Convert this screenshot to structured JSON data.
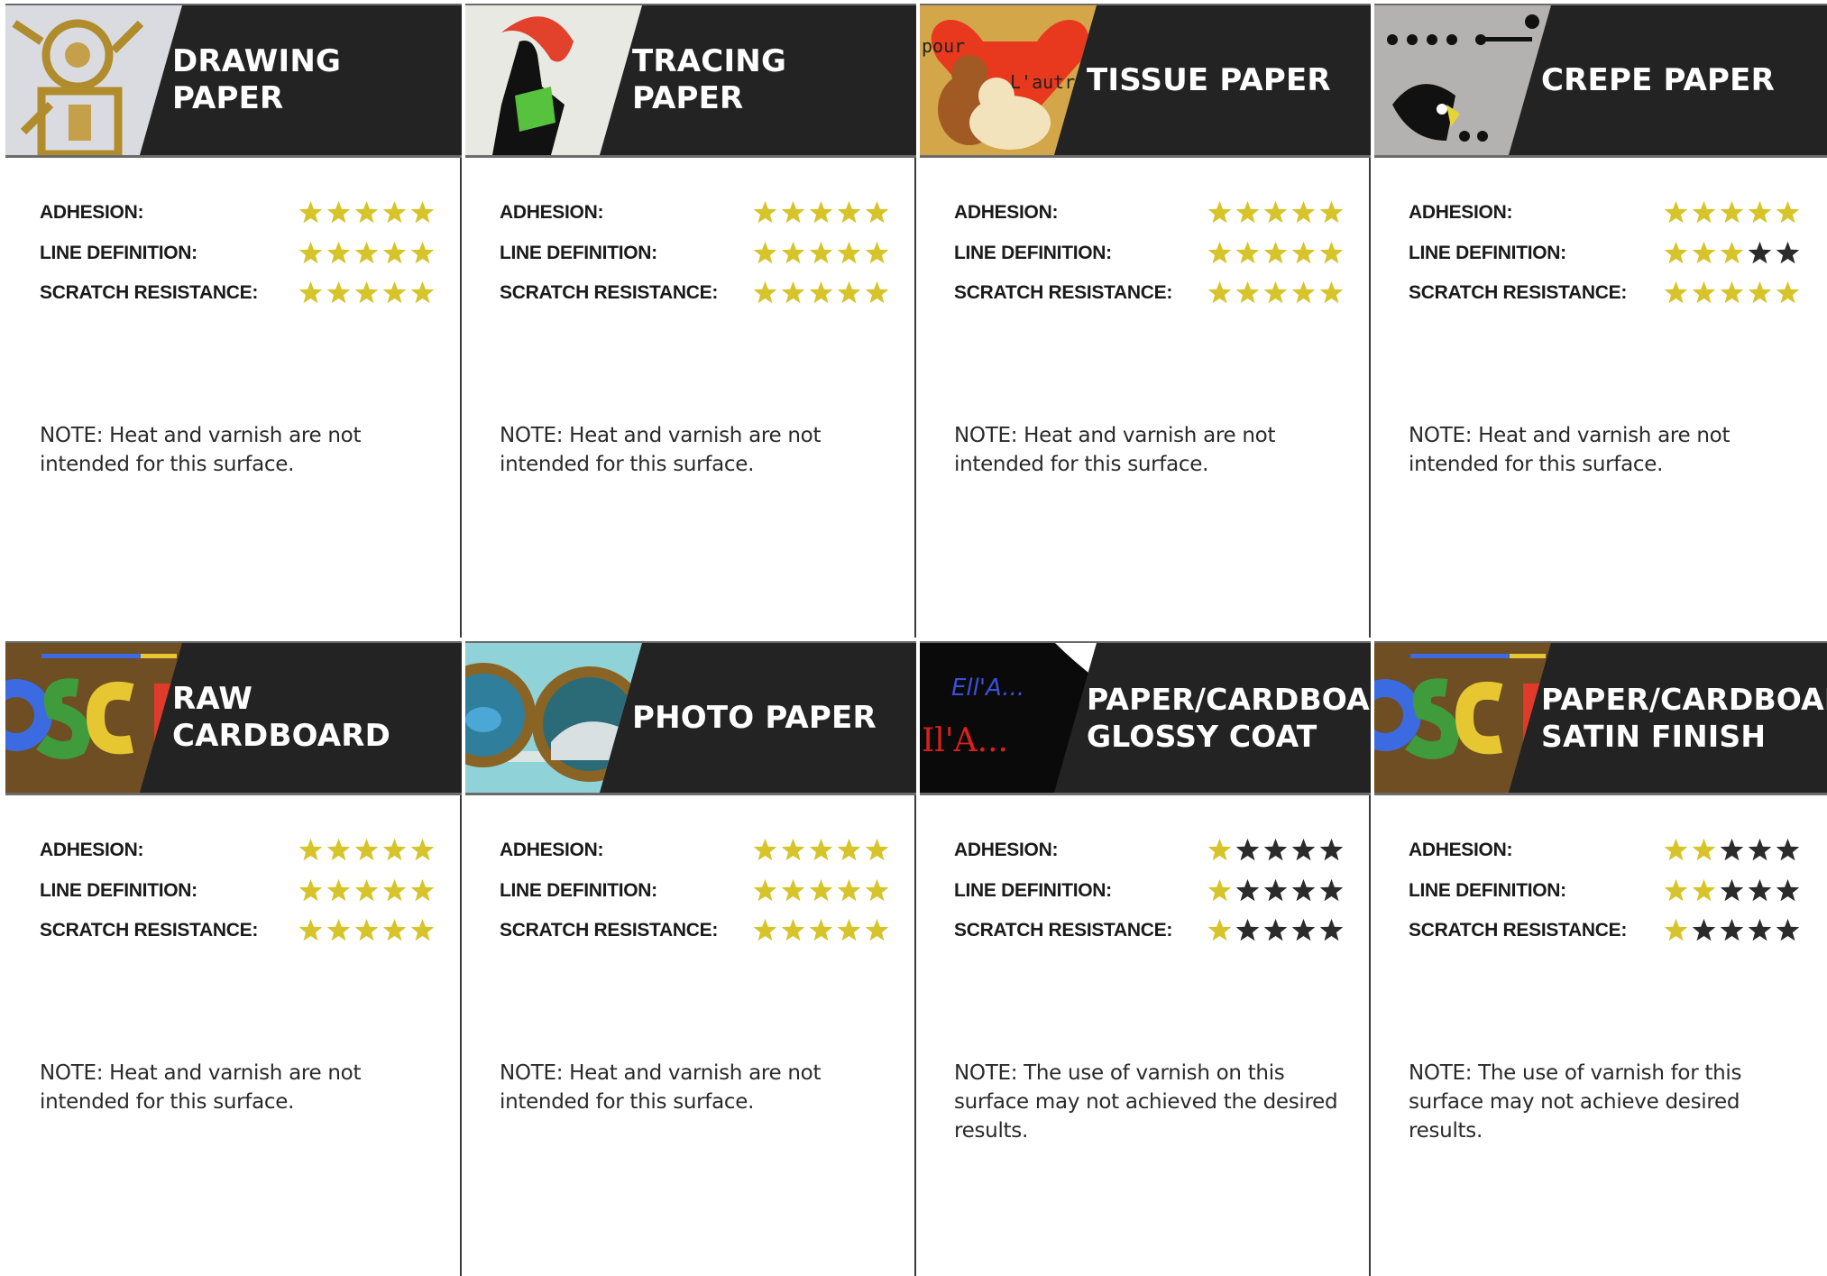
{
  "colors": {
    "star_filled": "#d6c42a",
    "star_empty": "#2b2b2b",
    "header_bg": "#242323"
  },
  "cards": [
    {
      "title_lines": [
        "DRAWING PAPER"
      ],
      "thumbnail": "aztec-drawing-icon",
      "ratings": [
        {
          "label": "ADHESION:",
          "value": 5,
          "max": 5
        },
        {
          "label": "LINE DEFINITION:",
          "value": 5,
          "max": 5
        },
        {
          "label": "SCRATCH RESISTANCE:",
          "value": 5,
          "max": 5
        }
      ],
      "note": "NOTE: Heat and varnish are not intended for this surface."
    },
    {
      "title_lines": [
        "TRACING PAPER"
      ],
      "thumbnail": "woman-silhouette-icon",
      "ratings": [
        {
          "label": "ADHESION:",
          "value": 5,
          "max": 5
        },
        {
          "label": "LINE DEFINITION:",
          "value": 5,
          "max": 5
        },
        {
          "label": "SCRATCH RESISTANCE:",
          "value": 5,
          "max": 5
        }
      ],
      "note": "NOTE: Heat and varnish are not intended for this surface."
    },
    {
      "title_lines": [
        "TISSUE PAPER"
      ],
      "thumbnail": "cats-heart-icon",
      "thumbnail_text": [
        "pour",
        "L'autre"
      ],
      "ratings": [
        {
          "label": "ADHESION:",
          "value": 5,
          "max": 5
        },
        {
          "label": "LINE DEFINITION:",
          "value": 5,
          "max": 5
        },
        {
          "label": "SCRATCH RESISTANCE:",
          "value": 5,
          "max": 5
        }
      ],
      "note": "NOTE: Heat and varnish are not intended for this surface."
    },
    {
      "title_lines": [
        "CREPE PAPER"
      ],
      "thumbnail": "bird-dragonfly-icon",
      "ratings": [
        {
          "label": "ADHESION:",
          "value": 5,
          "max": 5
        },
        {
          "label": "LINE DEFINITION:",
          "value": 3,
          "max": 5
        },
        {
          "label": "SCRATCH RESISTANCE:",
          "value": 5,
          "max": 5
        }
      ],
      "note": "NOTE: Heat and varnish are not intended for this surface."
    },
    {
      "title_lines": [
        "RAW CARDBOARD"
      ],
      "thumbnail": "colored-letters-icon",
      "thumbnail_text": [
        "OSC"
      ],
      "ratings": [
        {
          "label": "ADHESION:",
          "value": 5,
          "max": 5
        },
        {
          "label": "LINE DEFINITION:",
          "value": 5,
          "max": 5
        },
        {
          "label": "SCRATCH RESISTANCE:",
          "value": 5,
          "max": 5
        }
      ],
      "note": "NOTE: Heat and varnish are not intended for this surface."
    },
    {
      "title_lines": [
        "PHOTO PAPER"
      ],
      "thumbnail": "portholes-icon",
      "ratings": [
        {
          "label": "ADHESION:",
          "value": 5,
          "max": 5
        },
        {
          "label": "LINE DEFINITION:",
          "value": 5,
          "max": 5
        },
        {
          "label": "SCRATCH RESISTANCE:",
          "value": 5,
          "max": 5
        }
      ],
      "note": "NOTE: Heat and varnish are not intended for this surface."
    },
    {
      "title_lines": [
        "PAPER/CARDBOARD",
        "GLOSSY COAT"
      ],
      "thumbnail": "chalk-writing-icon",
      "thumbnail_text": [
        "Ell'A...",
        "Il'A..."
      ],
      "ratings": [
        {
          "label": "ADHESION:",
          "value": 1,
          "max": 5
        },
        {
          "label": "LINE DEFINITION:",
          "value": 1,
          "max": 5
        },
        {
          "label": "SCRATCH RESISTANCE:",
          "value": 1,
          "max": 5
        }
      ],
      "note": "NOTE: The use of varnish on this surface may not achieved the desired results."
    },
    {
      "title_lines": [
        "PAPER/CARDBOARD",
        "SATIN FINISH"
      ],
      "thumbnail": "colored-letters-icon",
      "thumbnail_text": [
        "OSC"
      ],
      "ratings": [
        {
          "label": "ADHESION:",
          "value": 2,
          "max": 5
        },
        {
          "label": "LINE DEFINITION:",
          "value": 2,
          "max": 5
        },
        {
          "label": "SCRATCH RESISTANCE:",
          "value": 1,
          "max": 5
        }
      ],
      "note": "NOTE: The use of varnish for this surface may not achieve desired results."
    }
  ]
}
